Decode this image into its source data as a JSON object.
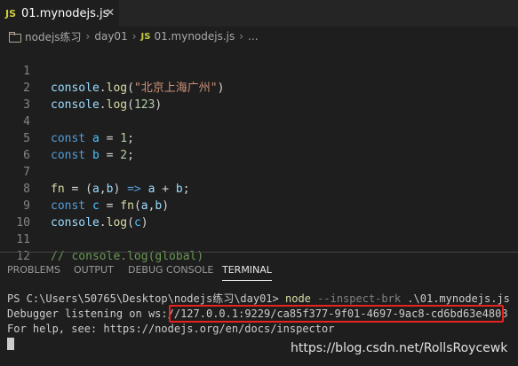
{
  "tab": {
    "badge": "JS",
    "filename": "01.mynodejs.js",
    "close": "✕"
  },
  "breadcrumb": {
    "items": [
      "nodejs练习",
      "day01",
      "01.mynodejs.js",
      "..."
    ],
    "badge": "JS",
    "separator": "›"
  },
  "editor": {
    "line_numbers": [
      "1",
      "2",
      "3",
      "4",
      "5",
      "6",
      "7",
      "8",
      "9",
      "10",
      "11",
      "12"
    ],
    "lines": [
      [
        "console",
        ".",
        "log",
        "(",
        "\"北京上海广州\"",
        ")"
      ],
      [
        "console",
        ".",
        "log",
        "(",
        "123",
        ")"
      ],
      [],
      [
        "const",
        " ",
        "a",
        " = ",
        "1",
        ";"
      ],
      [
        "const",
        " ",
        "b",
        " = ",
        "2",
        ";"
      ],
      [],
      [
        "fn",
        " = (",
        "a",
        ",",
        "b",
        ") ",
        "=>",
        " ",
        "a",
        " + ",
        "b",
        ";"
      ],
      [
        "const",
        " ",
        "c",
        " = ",
        "fn",
        "(",
        "a",
        ",",
        "b",
        ")"
      ],
      [
        "console",
        ".",
        "log",
        "(",
        "c",
        ")"
      ],
      [],
      [
        "// console.log(global)"
      ],
      []
    ]
  },
  "panel": {
    "tabs": [
      "PROBLEMS",
      "OUTPUT",
      "DEBUG CONSOLE",
      "TERMINAL"
    ],
    "active_tab": "TERMINAL"
  },
  "terminal": {
    "prompt": "PS C:\\Users\\50765\\Desktop\\nodejs练习\\day01>",
    "command": "node",
    "flag": "--inspect-brk",
    "arg": ".\\01.mynodejs.js",
    "debugger_prefix": "Debugger listening on ws:/",
    "debugger_url": "/127.0.0.1:9229/ca85f377-9f01-4697-9ac8-cd6bd63e4808",
    "help_line": "For help, see: https://nodejs.org/en/docs/inspector"
  },
  "watermark": "https://blog.csdn.net/RollsRoycewk",
  "colors": {
    "highlight_box": "#e8231e",
    "js_badge": "#cbcb41",
    "background": "#1e1e1e"
  }
}
